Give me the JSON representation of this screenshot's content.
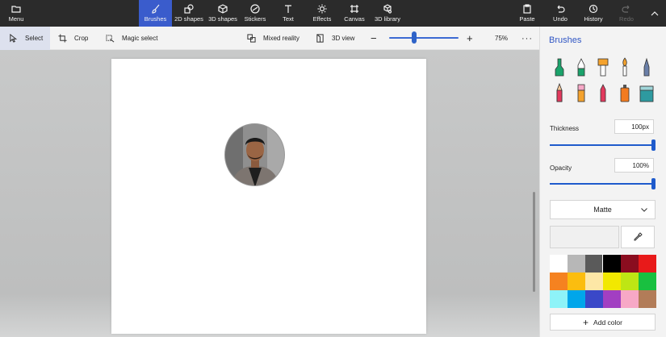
{
  "topbar": {
    "menu": "Menu",
    "tabs": [
      {
        "id": "brushes",
        "label": "Brushes",
        "icon": "brush-icon"
      },
      {
        "id": "2d-shapes",
        "label": "2D shapes",
        "icon": "2d-shapes-icon"
      },
      {
        "id": "3d-shapes",
        "label": "3D shapes",
        "icon": "3d-shapes-icon"
      },
      {
        "id": "stickers",
        "label": "Stickers",
        "icon": "sticker-icon"
      },
      {
        "id": "text",
        "label": "Text",
        "icon": "text-icon"
      },
      {
        "id": "effects",
        "label": "Effects",
        "icon": "effects-icon"
      },
      {
        "id": "canvas",
        "label": "Canvas",
        "icon": "canvas-icon"
      },
      {
        "id": "3d-library",
        "label": "3D library",
        "icon": "3d-library-icon"
      }
    ],
    "active_tab": "brushes",
    "paste": "Paste",
    "undo": "Undo",
    "history": "History",
    "redo": "Redo"
  },
  "cmdbar": {
    "select": "Select",
    "crop": "Crop",
    "magic_select": "Magic select",
    "mixed_reality": "Mixed reality",
    "view_3d": "3D view",
    "zoom": "75%",
    "zoom_level": 0.36
  },
  "panel": {
    "title": "Brushes",
    "brushes": [
      {
        "name": "marker",
        "color": "#1aa36b"
      },
      {
        "name": "calligraphy-pen",
        "color": "#1aa36b"
      },
      {
        "name": "oil-brush",
        "color": "#f4a22d"
      },
      {
        "name": "watercolor",
        "color": "#f4a22d"
      },
      {
        "name": "pixel-pen",
        "color": "#6a7fa8"
      },
      {
        "name": "pencil",
        "color": "#e2395d"
      },
      {
        "name": "eraser",
        "color": "#e2395d"
      },
      {
        "name": "crayon",
        "color": "#e2395d"
      },
      {
        "name": "spray-can",
        "color": "#f27b1f"
      },
      {
        "name": "fill",
        "color": "#2e9aa0"
      }
    ],
    "thickness_label": "Thickness",
    "thickness_value": "100px",
    "thickness_level": 1.0,
    "opacity_label": "Opacity",
    "opacity_value": "100%",
    "opacity_level": 1.0,
    "material": "Matte",
    "swatches": [
      "#ffffff",
      "#b7b7b7",
      "#5a5a5a",
      "#000000",
      "#8a0d1f",
      "#e81a1a",
      "#f58220",
      "#fbbd0f",
      "#fde7a6",
      "#f2e800",
      "#bee614",
      "#19c040",
      "#8ef3f8",
      "#00a6ea",
      "#3a48c8",
      "#a23fc2",
      "#f7a8c6",
      "#b27c58"
    ],
    "selected_swatch": 3,
    "add_color": "Add color"
  }
}
